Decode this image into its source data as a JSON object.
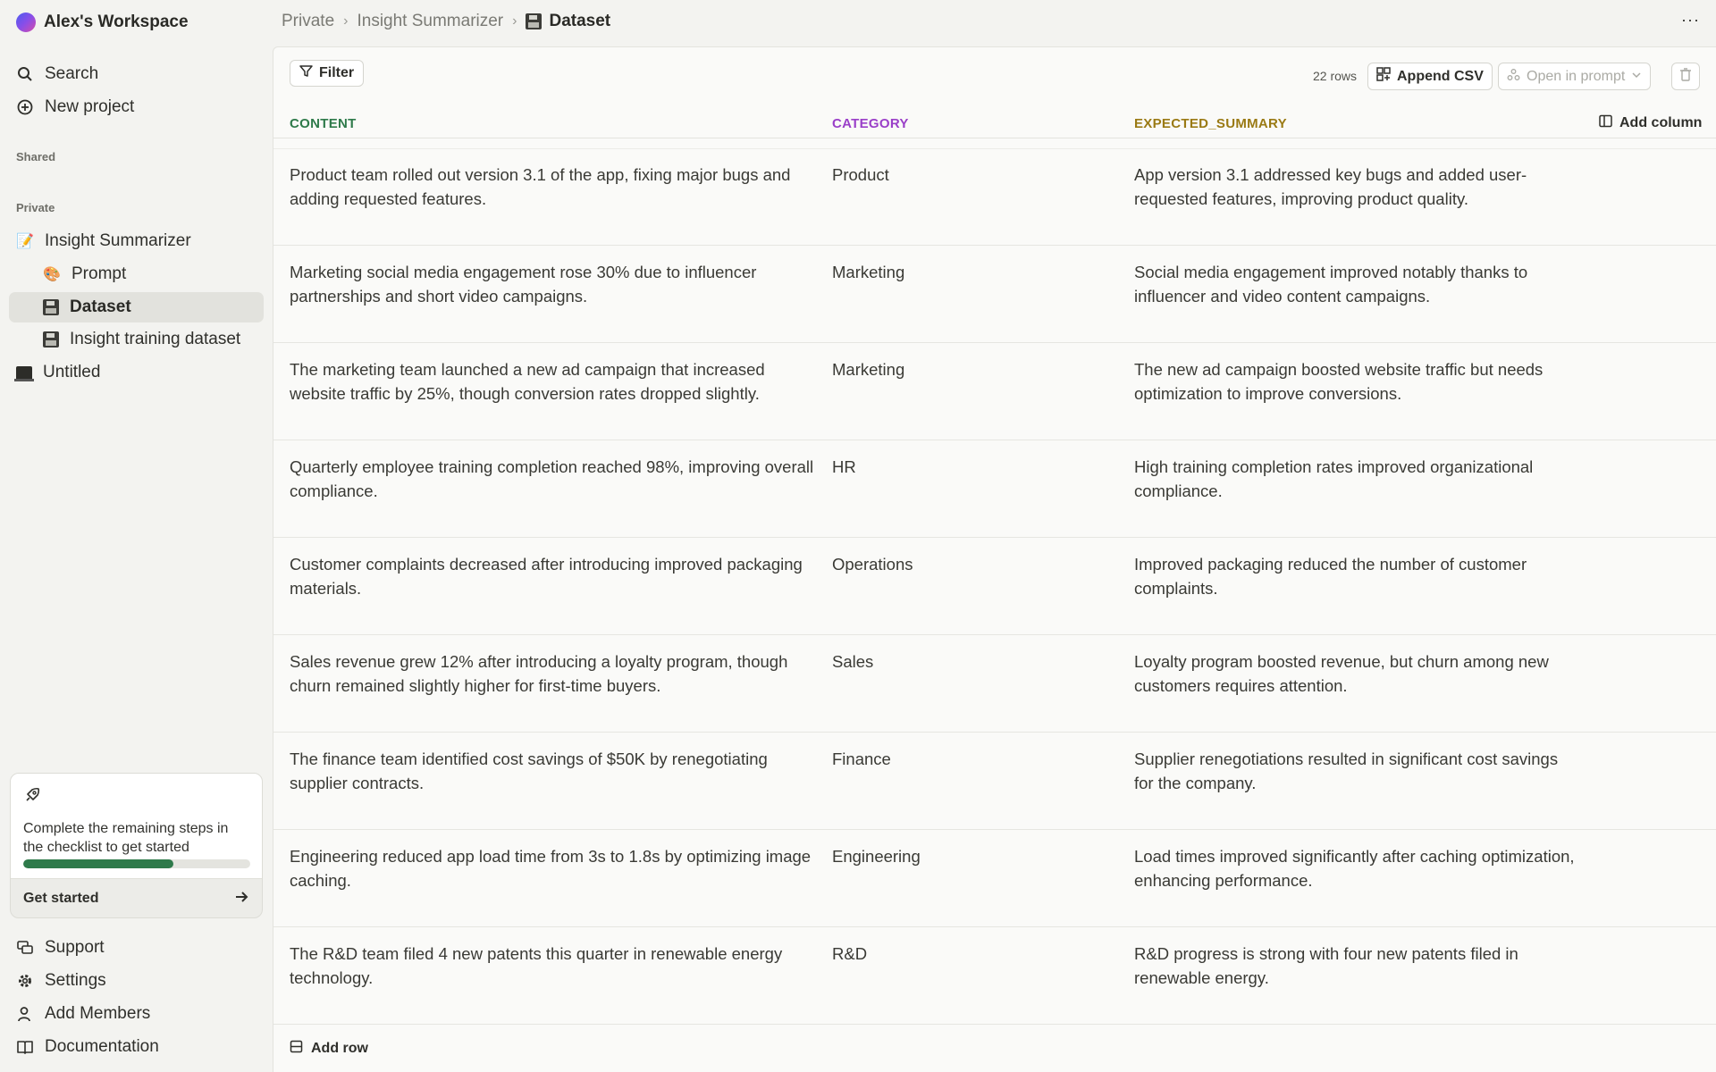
{
  "workspace": {
    "name": "Alex's Workspace"
  },
  "sidebar": {
    "top_items": [
      {
        "label": "Search",
        "icon": "search-icon"
      },
      {
        "label": "New project",
        "icon": "plus-circle-icon"
      }
    ],
    "shared_label": "Shared",
    "private_label": "Private",
    "tree": [
      {
        "label": "Insight Summarizer",
        "icon": "memo-icon",
        "level": 0
      },
      {
        "label": "Prompt",
        "icon": "palette-icon",
        "level": 1
      },
      {
        "label": "Dataset",
        "icon": "floppy-disk-icon",
        "level": 1,
        "active": true
      },
      {
        "label": "Insight training dataset",
        "icon": "floppy-disk-icon",
        "level": 1
      },
      {
        "label": "Untitled",
        "icon": "laptop-icon",
        "level": 0
      }
    ],
    "checklist": {
      "text": "Complete the remaining steps in the checklist to get started",
      "progress": 0.66,
      "cta": "Get started"
    },
    "bottom_items": [
      {
        "label": "Support",
        "icon": "chat-icon"
      },
      {
        "label": "Settings",
        "icon": "gear-icon"
      },
      {
        "label": "Add Members",
        "icon": "user-plus-icon"
      },
      {
        "label": "Documentation",
        "icon": "book-icon"
      }
    ]
  },
  "breadcrumb": {
    "items": [
      "Private",
      "Insight Summarizer"
    ],
    "current": "Dataset"
  },
  "toolbar": {
    "filter_label": "Filter",
    "rows_count": "22 rows",
    "append_csv_label": "Append CSV",
    "open_in_prompt_label": "Open in prompt",
    "add_column_label": "Add column",
    "add_row_label": "Add row"
  },
  "table": {
    "columns": [
      {
        "label": "CONTENT",
        "color": "#2e7a4a"
      },
      {
        "label": "CATEGORY",
        "color": "#9a3fc8"
      },
      {
        "label": "EXPECTED_SUMMARY",
        "color": "#9a7a14"
      }
    ],
    "rows": [
      [
        "Product team rolled out version 3.1 of the app, fixing major bugs and adding requested features.",
        "Product",
        "App version 3.1 addressed key bugs and added user-requested features, improving product quality."
      ],
      [
        "Marketing social media engagement rose 30% due to influencer partnerships and short video campaigns.",
        "Marketing",
        "Social media engagement improved notably thanks to influencer and video content campaigns."
      ],
      [
        "The marketing team launched a new ad campaign that increased website traffic by 25%, though conversion rates dropped slightly.",
        "Marketing",
        "The new ad campaign boosted website traffic but needs optimization to improve conversions."
      ],
      [
        "Quarterly employee training completion reached 98%, improving overall compliance.",
        "HR",
        "High training completion rates improved organizational compliance."
      ],
      [
        "Customer complaints decreased after introducing improved packaging materials.",
        "Operations",
        "Improved packaging reduced the number of customer complaints."
      ],
      [
        "Sales revenue grew 12% after introducing a loyalty program, though churn remained slightly higher for first-time buyers.",
        "Sales",
        "Loyalty program boosted revenue, but churn among new customers requires attention."
      ],
      [
        "The finance team identified cost savings of $50K by renegotiating supplier contracts.",
        "Finance",
        "Supplier renegotiations resulted in significant cost savings for the company."
      ],
      [
        "Engineering reduced app load time from 3s to 1.8s by optimizing image caching.",
        "Engineering",
        "Load times improved significantly after caching optimization, enhancing performance."
      ],
      [
        "The R&D team filed 4 new patents this quarter in renewable energy technology.",
        "R&D",
        "R&D progress is strong with four new patents filed in renewable energy."
      ]
    ]
  }
}
